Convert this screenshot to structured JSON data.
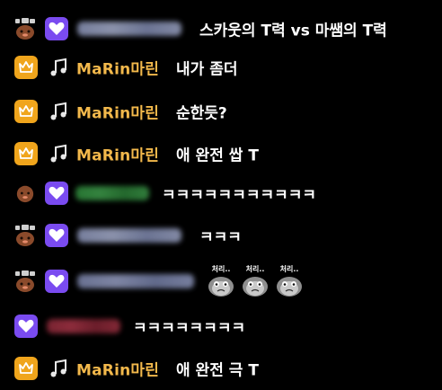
{
  "colors": {
    "background": "#000000",
    "nickname_gold": "#f2b84b",
    "message_text": "#ffffff",
    "badge_purple": "#7a4bf0",
    "badge_gold": "#f0a51c"
  },
  "icons": {
    "avatar": "gamepad-face-icon",
    "subscriber_badge": "heart-icon",
    "vip_badge": "crown-icon",
    "music_badge": "music-note-icon",
    "sticker": "crying-face-sticker"
  },
  "sticker_label": "처리..",
  "messages": [
    {
      "kind": "blurred",
      "nickname": "",
      "text": "스카웃의 T력 vs 마쌤의 T력"
    },
    {
      "kind": "named",
      "nickname": "MaRin마린",
      "text": "내가 좀더"
    },
    {
      "kind": "named",
      "nickname": "MaRin마린",
      "text": "순한듯?"
    },
    {
      "kind": "named",
      "nickname": "MaRin마린",
      "text": "애 완전 쌉 T"
    },
    {
      "kind": "blurred",
      "nickname": "",
      "text": "ㅋㅋㅋㅋㅋㅋㅋㅋㅋㅋㅋ"
    },
    {
      "kind": "blurred",
      "nickname": "",
      "text": "ㅋㅋㅋ"
    },
    {
      "kind": "blurred-sticker",
      "nickname": "",
      "text": ""
    },
    {
      "kind": "blurred-solo",
      "nickname": "",
      "text": "ㅋㅋㅋㅋㅋㅋㅋㅋ"
    },
    {
      "kind": "named",
      "nickname": "MaRin마린",
      "text": "애 완전 극 T"
    }
  ]
}
